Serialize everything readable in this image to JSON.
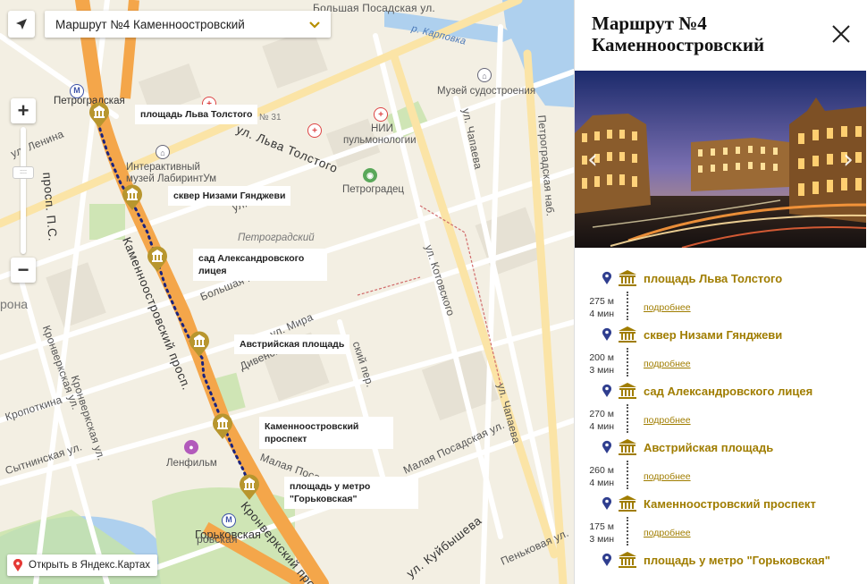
{
  "route_select": {
    "label": "Маршрут №4 Каменноостровский",
    "chevron_icon": "chevron-down-icon"
  },
  "map": {
    "open_link": "Открыть в Яндекс.Картах",
    "metro": [
      {
        "label": "Петроградская"
      },
      {
        "label": "Горьковская"
      }
    ],
    "places": [
      {
        "label": "Поликлиника № 31"
      },
      {
        "label": "НИИ"
      },
      {
        "label": "пульмонологии"
      },
      {
        "label": "Музей судостроения"
      },
      {
        "label": "Интерактивный"
      },
      {
        "label": "музей ЛабиринтУм"
      },
      {
        "label": "Петроградец"
      },
      {
        "label": "Петроградский"
      },
      {
        "label": "Ленфильм"
      },
      {
        "label": "рона"
      }
    ],
    "streets": [
      {
        "label": "ул. Льва Толстого"
      },
      {
        "label": "Каменноостровский просп."
      },
      {
        "label": "ул. Чапаева"
      },
      {
        "label": "ул. Чапаева"
      },
      {
        "label": "ул. Котовского"
      },
      {
        "label": "Петроградская наб."
      },
      {
        "label": "ул. Мира"
      },
      {
        "label": "Дивенская ул."
      },
      {
        "label": "Большая Монетная ул."
      },
      {
        "label": "Кронверкская ул."
      },
      {
        "label": "Кронверкский просп."
      },
      {
        "label": "Малая Посадская ул."
      },
      {
        "label": "Малая Посадская ул."
      },
      {
        "label": "ул. Куйбышева"
      },
      {
        "label": "Пеньковая ул."
      },
      {
        "label": "Сытнинская ул."
      },
      {
        "label": "Кропоткина"
      },
      {
        "label": "Кронверкская ул."
      },
      {
        "label": "просп. П.С."
      },
      {
        "label": "ул. Рентг"
      },
      {
        "label": "р. Карповка"
      },
      {
        "label": "ул. Ленина"
      },
      {
        "label": "ский пер."
      },
      {
        "label": "Большая Посадская ул."
      },
      {
        "label": "ровская"
      }
    ]
  },
  "stops": [
    {
      "name": "площадь Льва Толстого",
      "map_label": "площадь Льва Толстого",
      "distance": "275 м",
      "time": "4 мин",
      "more": "подробнее"
    },
    {
      "name": "сквер Низами Гянджеви",
      "map_label": "сквер Низами Гянджеви",
      "distance": "200 м",
      "time": "3 мин",
      "more": "подробнее"
    },
    {
      "name": "сад Александровского лицея",
      "map_label": "сад Александровского лицея",
      "distance": "270 м",
      "time": "4 мин",
      "more": "подробнее"
    },
    {
      "name": "Австрийская площадь",
      "map_label": "Австрийская площадь",
      "distance": "260 м",
      "time": "4 мин",
      "more": "подробнее"
    },
    {
      "name": "Каменноостровский проспект",
      "map_label": "Каменноостровский проспект",
      "distance": "175 м",
      "time": "3 мин",
      "more": "подробнее"
    },
    {
      "name": "площадь у метро \"Горьковская\"",
      "map_label": "площадь у метро \"Горьковская\""
    }
  ],
  "panel": {
    "title": "Маршрут №4 Каменноостровский",
    "close_icon": "close-icon",
    "prev_icon": "chevron-left-icon",
    "next_icon": "chevron-right-icon"
  },
  "colors": {
    "accent_gold": "#a07d00",
    "pin_gold": "#b8962e",
    "pin_blue": "#2f3e8f",
    "route_dots": "#1a237e",
    "main_road": "#f4a64a"
  }
}
